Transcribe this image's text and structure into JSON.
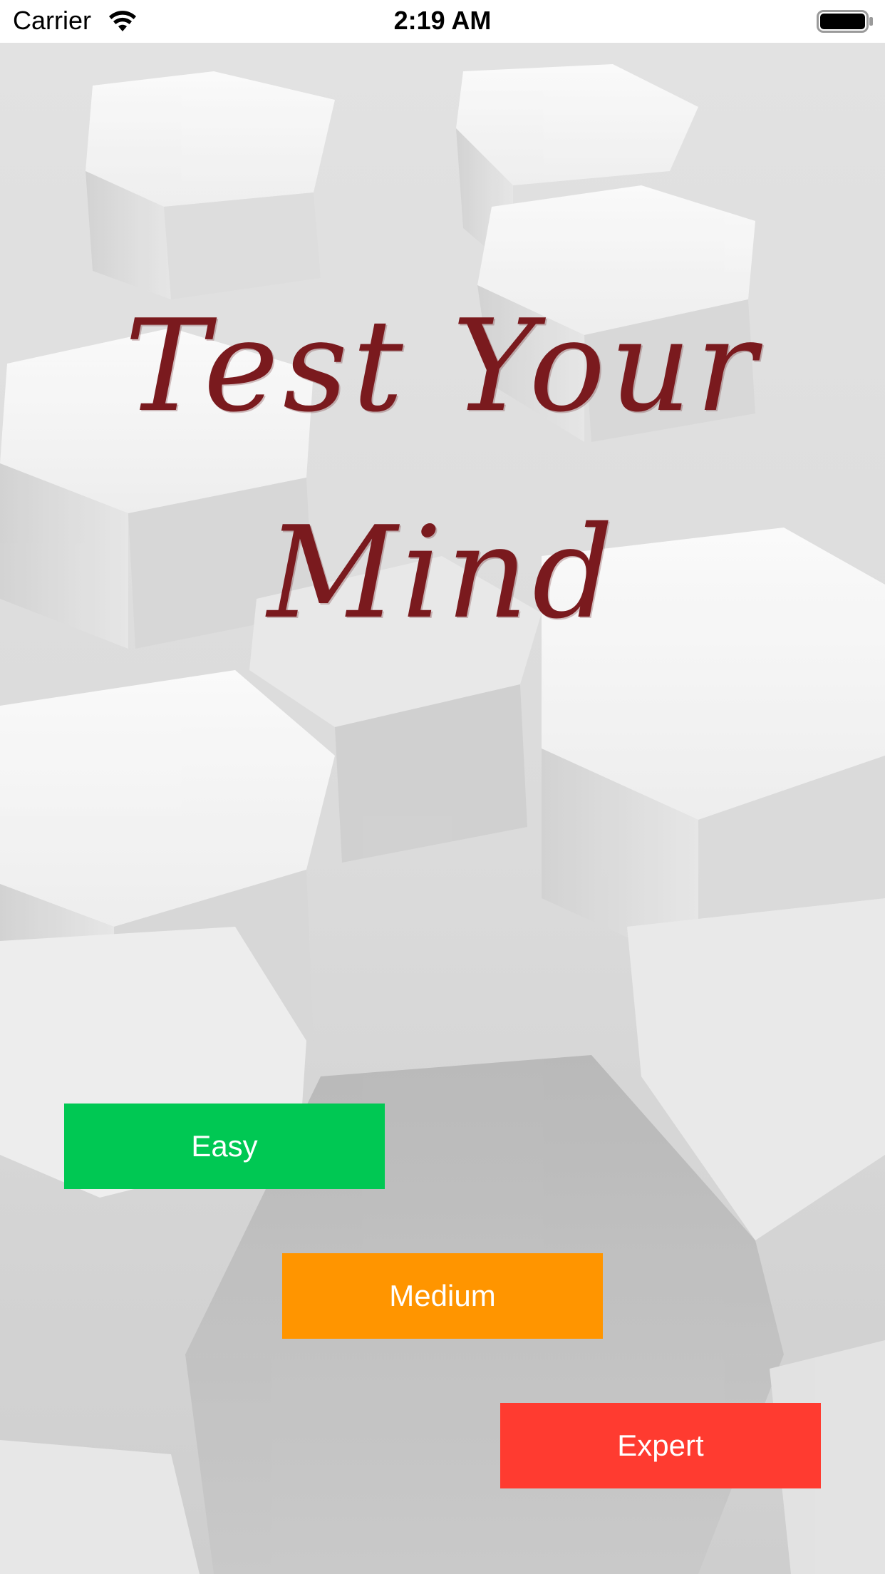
{
  "status_bar": {
    "carrier": "Carrier",
    "time": "2:19 AM",
    "wifi_icon": "wifi-icon",
    "battery_icon": "battery-icon"
  },
  "title": {
    "line1": "Test Your",
    "line2": "Mind",
    "color": "#7a1a1e"
  },
  "buttons": {
    "easy": {
      "label": "Easy",
      "color": "#00c853"
    },
    "medium": {
      "label": "Medium",
      "color": "#ff9500"
    },
    "expert": {
      "label": "Expert",
      "color": "#ff3b30"
    }
  },
  "background": {
    "description_icon": "hexagon-pattern"
  }
}
